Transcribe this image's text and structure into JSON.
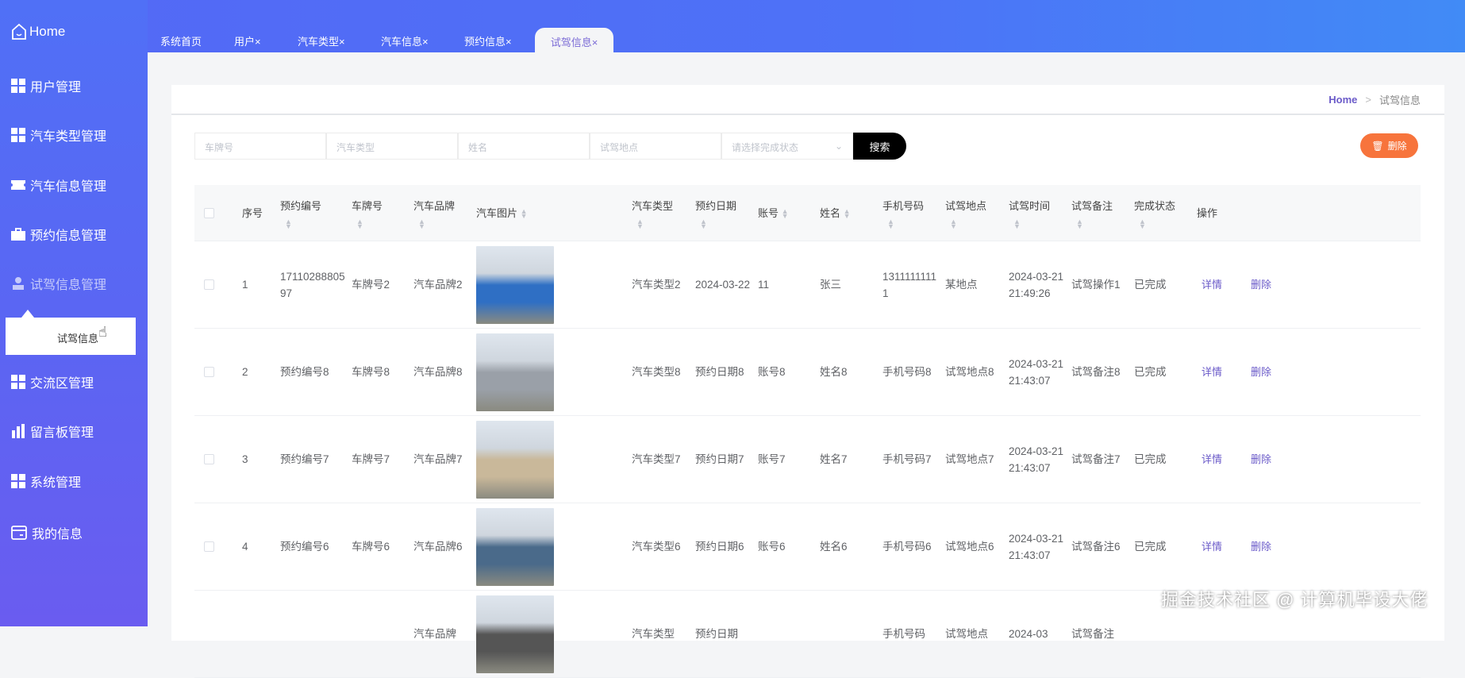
{
  "sidebar": {
    "home": "Home",
    "items": [
      {
        "label": "用户管理",
        "icon": "grid-icon"
      },
      {
        "label": "汽车类型管理",
        "icon": "grid-icon"
      },
      {
        "label": "汽车信息管理",
        "icon": "ticket-icon"
      },
      {
        "label": "预约信息管理",
        "icon": "briefcase-icon"
      },
      {
        "label": "试驾信息管理",
        "icon": "user-icon"
      },
      {
        "label": "交流区管理",
        "icon": "grid-icon"
      },
      {
        "label": "留言板管理",
        "icon": "bar-chart-icon"
      },
      {
        "label": "系统管理",
        "icon": "grid-icon"
      },
      {
        "label": "我的信息",
        "icon": "card-icon"
      }
    ],
    "submenu": "试驾信息"
  },
  "tabs": [
    {
      "label": "系统首页"
    },
    {
      "label": "用户×"
    },
    {
      "label": "汽车类型×"
    },
    {
      "label": "汽车信息×"
    },
    {
      "label": "预约信息×"
    },
    {
      "label": "试驾信息×",
      "active": true
    }
  ],
  "breadcrumb": {
    "home": "Home",
    "sep": ">",
    "current": "试驾信息"
  },
  "search": {
    "plate_placeholder": "车牌号",
    "type_placeholder": "汽车类型",
    "name_placeholder": "姓名",
    "place_placeholder": "试驾地点",
    "status_placeholder": "请选择完成状态",
    "button": "搜索"
  },
  "delete_button": "删除",
  "table": {
    "headers": [
      "序号",
      "预约编号",
      "车牌号",
      "汽车品牌",
      "汽车图片",
      "汽车类型",
      "预约日期",
      "账号",
      "姓名",
      "手机号码",
      "试驾地点",
      "试驾时间",
      "试驾备注",
      "完成状态",
      "操作"
    ],
    "actions": {
      "detail": "详情",
      "delete": "删除"
    },
    "rows": [
      {
        "no": "1",
        "code": "1711028880597",
        "plate": "车牌号2",
        "brand": "汽车品牌2",
        "type": "汽车类型2",
        "date": "2024-03-22",
        "account": "11",
        "name": "张三",
        "phone": "13111111111",
        "place": "某地点",
        "time": "2024-03-21 21:49:26",
        "note": "试驾操作1",
        "status": "已完成",
        "img": "#2f6fc4"
      },
      {
        "no": "2",
        "code": "预约编号8",
        "plate": "车牌号8",
        "brand": "汽车品牌8",
        "type": "汽车类型8",
        "date": "预约日期8",
        "account": "账号8",
        "name": "姓名8",
        "phone": "手机号码8",
        "place": "试驾地点8",
        "time": "2024-03-21 21:43:07",
        "note": "试驾备注8",
        "status": "已完成",
        "img": "#9aa0a8"
      },
      {
        "no": "3",
        "code": "预约编号7",
        "plate": "车牌号7",
        "brand": "汽车品牌7",
        "type": "汽车类型7",
        "date": "预约日期7",
        "account": "账号7",
        "name": "姓名7",
        "phone": "手机号码7",
        "place": "试驾地点7",
        "time": "2024-03-21 21:43:07",
        "note": "试驾备注7",
        "status": "已完成",
        "img": "#c9b89a"
      },
      {
        "no": "4",
        "code": "预约编号6",
        "plate": "车牌号6",
        "brand": "汽车品牌6",
        "type": "汽车类型6",
        "date": "预约日期6",
        "account": "账号6",
        "name": "姓名6",
        "phone": "手机号码6",
        "place": "试驾地点6",
        "time": "2024-03-21 21:43:07",
        "note": "试驾备注6",
        "status": "已完成",
        "img": "#4a6a8a"
      },
      {
        "no": "",
        "code": "",
        "plate": "",
        "brand": "汽车品牌",
        "type": "汽车类型",
        "date": "预约日期",
        "account": "",
        "name": "",
        "phone": "手机号码",
        "place": "试驾地点",
        "time": "2024-03",
        "note": "试驾备注",
        "status": "",
        "img": "#555"
      }
    ]
  },
  "watermark": "掘金技术社区 @ 计算机毕设大佬"
}
